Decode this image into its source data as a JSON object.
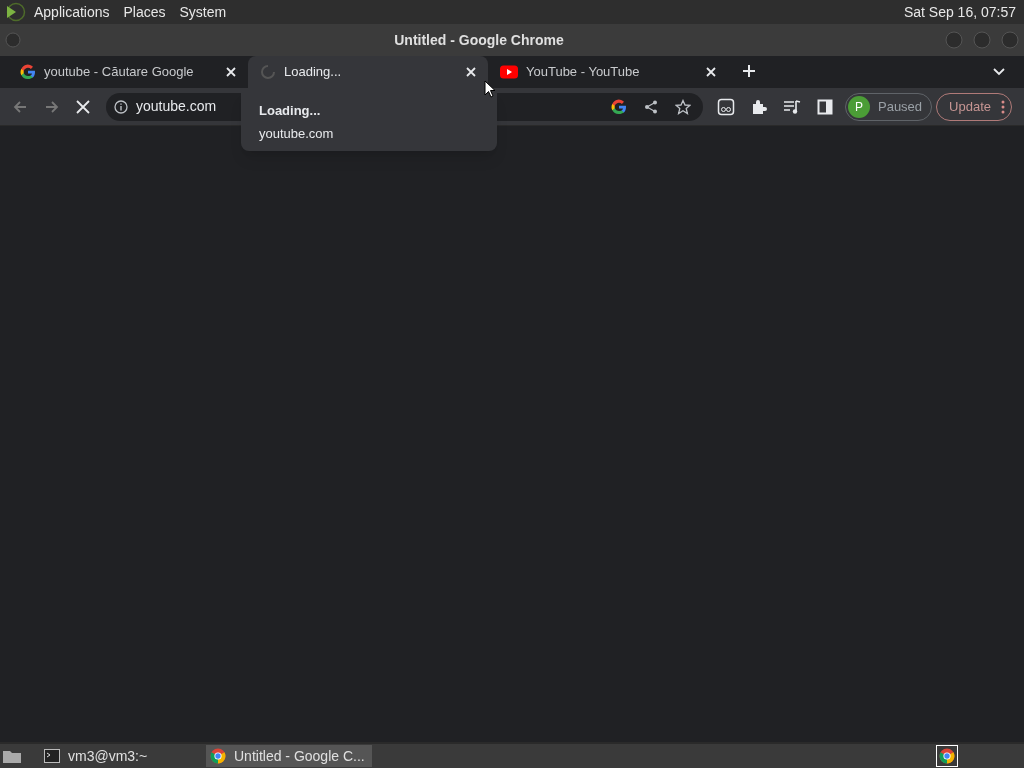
{
  "top_panel": {
    "menus": [
      "Applications",
      "Places",
      "System"
    ],
    "clock": "Sat Sep 16, 07:57"
  },
  "window": {
    "title": "Untitled - Google Chrome"
  },
  "tabs": [
    {
      "kind": "google",
      "title": "youtube - Căutare Google",
      "selected": false
    },
    {
      "kind": "loading",
      "title": "Loading...",
      "selected": true
    },
    {
      "kind": "youtube",
      "title": "YouTube - YouTube",
      "selected": false
    }
  ],
  "toolbar": {
    "url": "youtube.com",
    "profile_initial": "P",
    "profile_status": "Paused",
    "update": "Update"
  },
  "hover_card": {
    "title": "Loading...",
    "domain": "youtube.com"
  },
  "taskbar": {
    "windows": [
      {
        "kind": "terminal",
        "label": "vm3@vm3:~",
        "selected": false
      },
      {
        "kind": "chrome",
        "label": "Untitled - Google C...",
        "selected": true
      }
    ]
  }
}
